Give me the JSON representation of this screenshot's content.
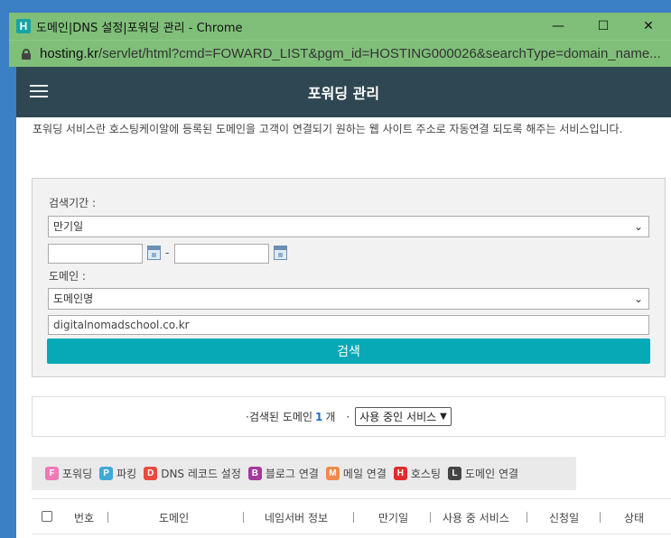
{
  "window": {
    "title": "도메인|DNS 설정|포워딩 관리 - Chrome",
    "app_icon_letter": "H",
    "url_host": "hosting.kr",
    "url_path": "/servlet/html?cmd=FOWARD_LIST&pgm_id=HOSTING000026&searchType=domain_name...",
    "minimize": "—",
    "maximize": "☐",
    "close": "✕"
  },
  "header": {
    "title": "포워딩 관리"
  },
  "description": "포워딩 서비스란 호스팅케이알에 등록된 도메인을 고객이 연결되기 원하는 웹 사이트 주소로 자동연결 되도록 해주는 서비스입니다.",
  "search": {
    "period_label": "검색기간 :",
    "period_value": "만기일",
    "date_from": "",
    "date_to": "",
    "date_dash": "-",
    "domain_label": "도메인 :",
    "domain_type_value": "도메인명",
    "domain_value": "digitalnomadschool.co.kr",
    "button": "검색"
  },
  "result": {
    "bullet": "·",
    "prefix": "검색된 도메인",
    "count": "1",
    "suffix": "개",
    "bullet2": "·",
    "service_filter": "사용 중인 서비스"
  },
  "legend": [
    {
      "letter": "F",
      "label": "포워딩",
      "color": "#f07ab8"
    },
    {
      "letter": "P",
      "label": "파킹",
      "color": "#3fa9d8"
    },
    {
      "letter": "D",
      "label": "DNS 레코드 설정",
      "color": "#e84a3c"
    },
    {
      "letter": "B",
      "label": "블로그 연결",
      "color": "#a23a9a"
    },
    {
      "letter": "M",
      "label": "메일 연결",
      "color": "#f08a4b"
    },
    {
      "letter": "H",
      "label": "호스팅",
      "color": "#e02c2c"
    },
    {
      "letter": "L",
      "label": "도메인 연결",
      "color": "#444444"
    }
  ],
  "table": {
    "columns": [
      "번호",
      "도메인",
      "네임서버 정보",
      "만기일",
      "사용 중 서비스",
      "신청일",
      "상태"
    ]
  }
}
